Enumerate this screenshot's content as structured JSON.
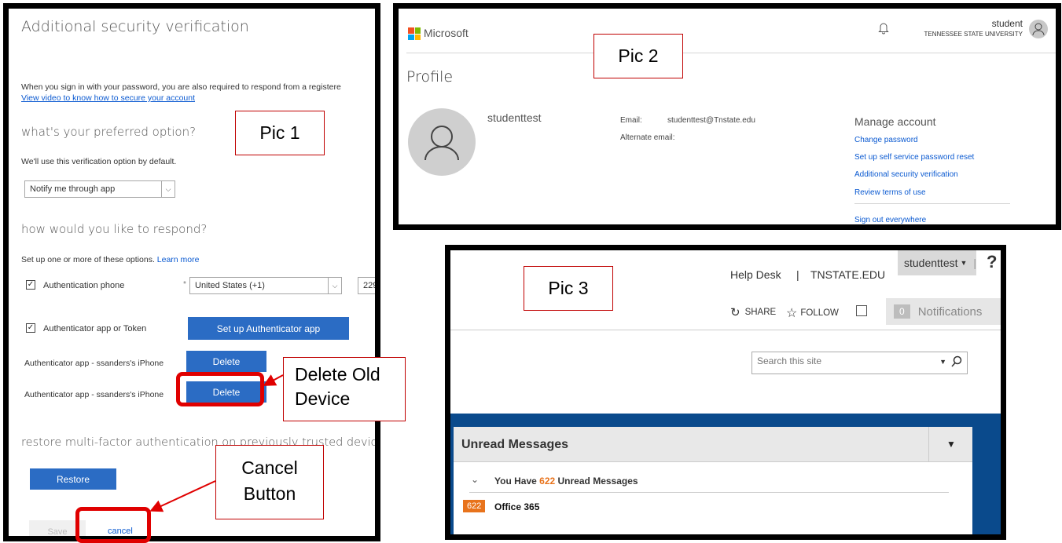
{
  "pic1": {
    "title": "Additional security verification",
    "intro": "When you sign in with your password, you are also required to respond from a registere",
    "video_link": "View video to know how to secure your account",
    "pref_heading": "what's your preferred option?",
    "pref_sub": "We'll use this verification option by default.",
    "pref_select": "Notify me through app",
    "respond_heading": "how would you like to respond?",
    "respond_sub": "Set up one or more of these options.",
    "learn_more": "Learn more",
    "auth_phone_label": "Authentication phone",
    "country_select": "United States (+1)",
    "phone_partial": "229",
    "auth_app_label": "Authenticator app or Token",
    "setup_app_button": "Set up Authenticator app",
    "device1_label": "Authenticator app - ssanders's iPhone",
    "device2_label": "Authenticator app - ssanders's iPhone",
    "delete_label": "Delete",
    "restore_heading": "restore multi-factor authentication on previously trusted device",
    "restore_button": "Restore",
    "save_button": "Save",
    "cancel_button": "cancel"
  },
  "pic2": {
    "brand": "Microsoft",
    "user_name": "student",
    "user_org": "TENNESSEE STATE UNIVERSITY",
    "profile_title": "Profile",
    "display_name": "studenttest",
    "email_label": "Email:",
    "email_value": "studenttest@Tnstate.edu",
    "alt_email_label": "Alternate email:",
    "manage_heading": "Manage account",
    "links": [
      "Change password",
      "Set up self service password reset",
      "Additional security verification",
      "Review terms of use"
    ],
    "sign_out": "Sign out everywhere"
  },
  "pic3": {
    "user_menu": "studenttest",
    "help_text": "?",
    "help_desk": "Help Desk",
    "separator": "|",
    "site": "TNSTATE.EDU",
    "share": "SHARE",
    "follow": "FOLLOW",
    "notif_count": "0",
    "notifications": "Notifications",
    "search_placeholder": "Search this site",
    "unread_heading": "Unread Messages",
    "you_have": "You Have",
    "unread_count": "622",
    "unread_suffix": "Unread Messages",
    "badge_count": "622",
    "office": "Office 365"
  },
  "callouts": {
    "pic1": "Pic 1",
    "pic2": "Pic 2",
    "pic3": "Pic 3",
    "delete_old_line1": "Delete Old",
    "delete_old_line2": "Device",
    "cancel_line1": "Cancel",
    "cancel_line2": "Button"
  },
  "colors": {
    "accent_blue": "#2b6cc4",
    "annotation_red": "#e00000",
    "sharepoint_blue": "#0a4a8c",
    "badge_orange": "#e8731c"
  }
}
